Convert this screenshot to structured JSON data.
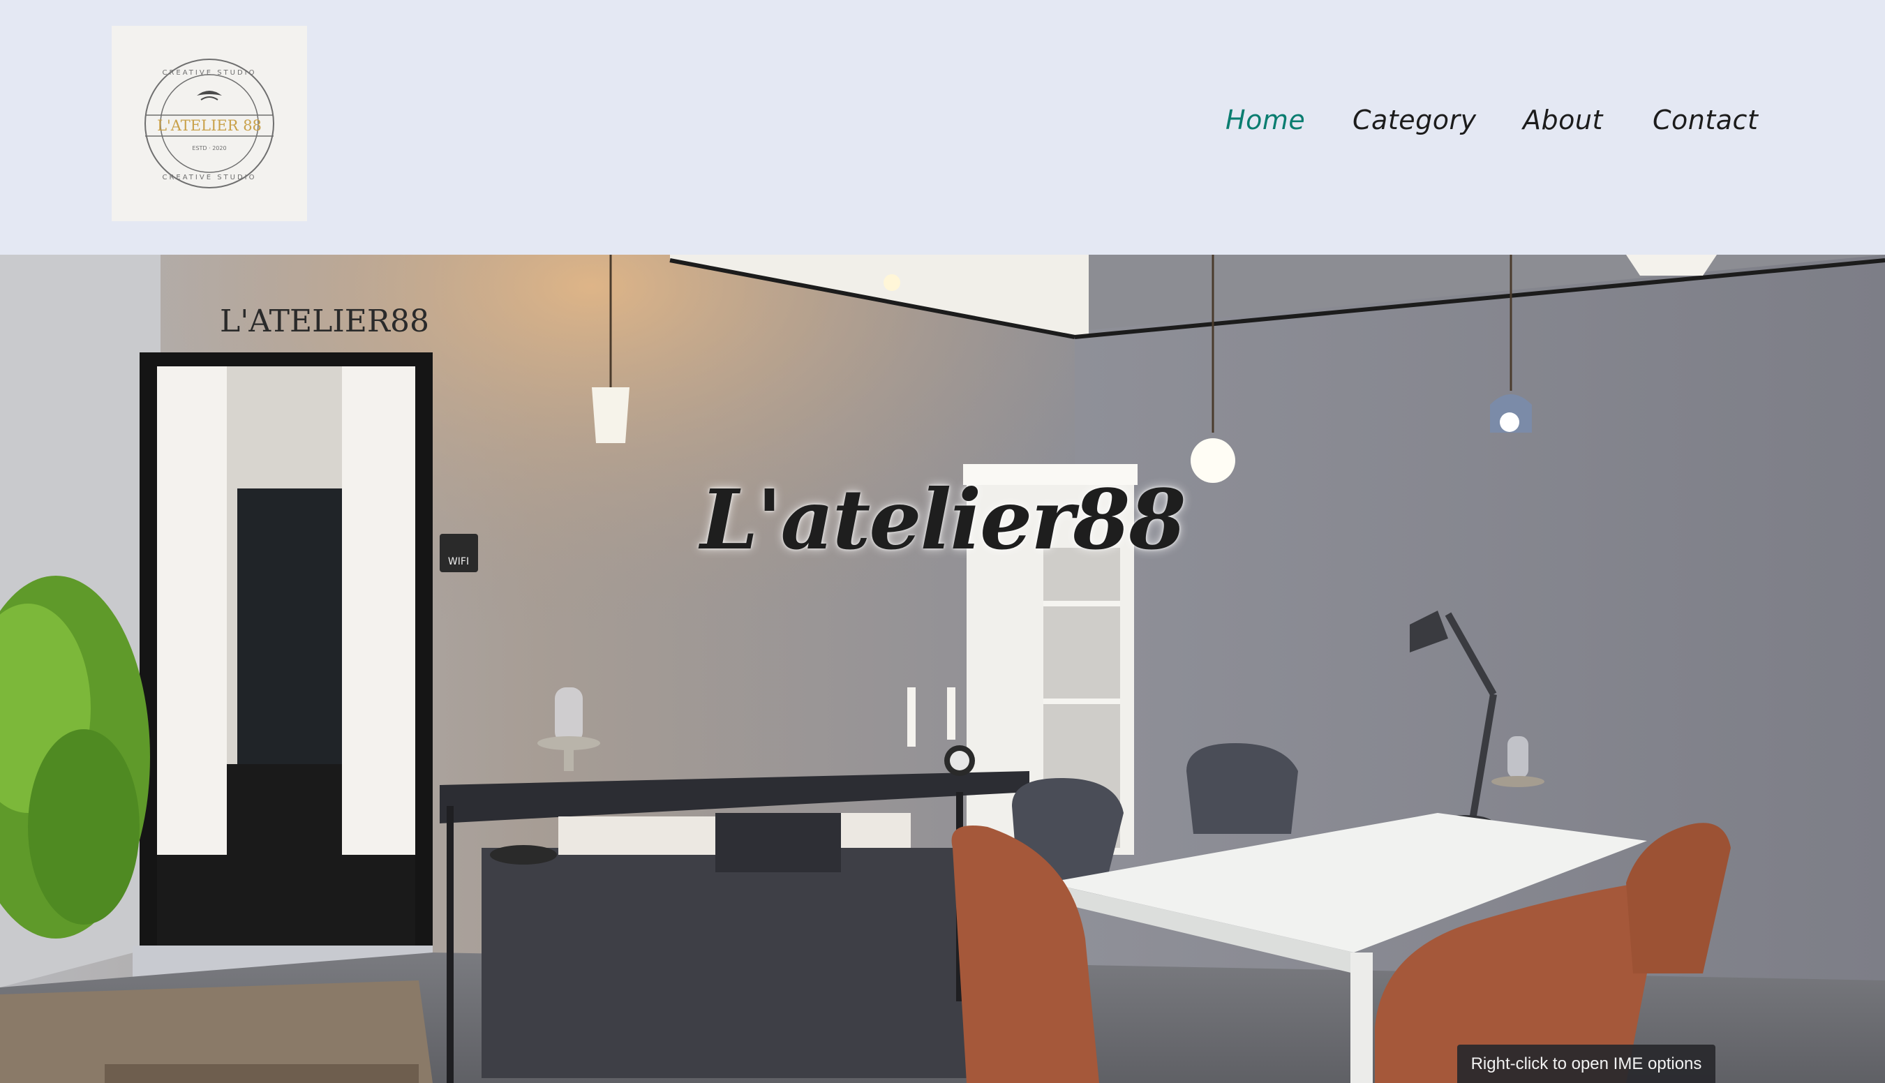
{
  "header": {
    "logo": {
      "text_main": "L'ATELIER 88",
      "text_ring_top": "CREATIVE STUDIO",
      "text_ring_bottom": "CREATIVE STUDIO",
      "text_small": "ESTD · 2020"
    },
    "nav": [
      {
        "label": "Home",
        "active": true
      },
      {
        "label": "Category",
        "active": false
      },
      {
        "label": "About",
        "active": false
      },
      {
        "label": "Contact",
        "active": false
      }
    ]
  },
  "hero": {
    "title": "L'atelier88",
    "wall_sign": "L'ATELIER88",
    "wifi_sign": "WIFI"
  },
  "tooltip": {
    "text": "Right-click to open IME options"
  },
  "colors": {
    "header_bg": "#e4e8f3",
    "nav_active": "#0a7d70",
    "nav_default": "#1c1c1c",
    "logo_gold": "#c9a14a"
  }
}
